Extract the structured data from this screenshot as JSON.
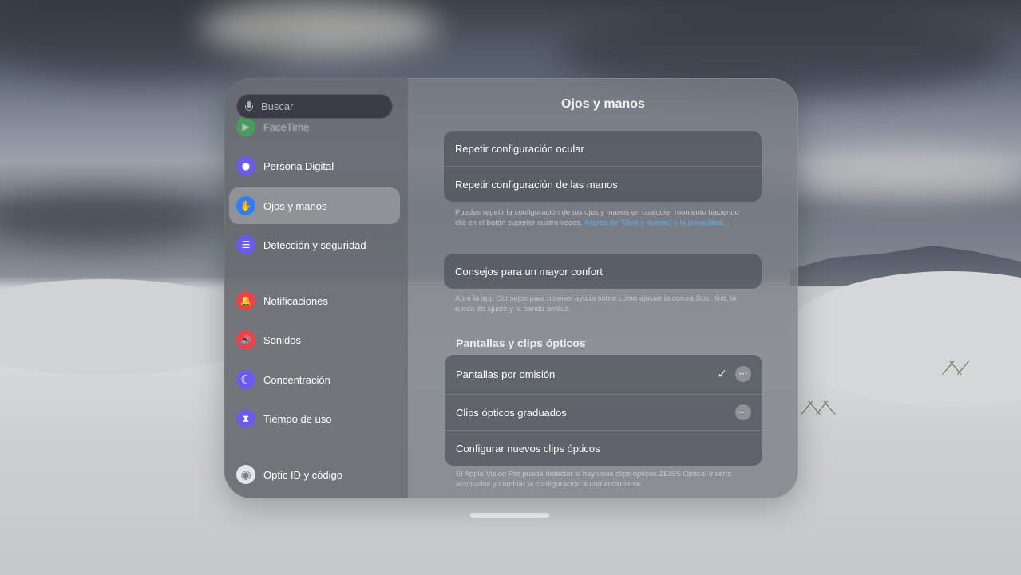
{
  "search": {
    "placeholder": "Buscar"
  },
  "sidebar": {
    "items": [
      {
        "label": "FaceTime",
        "icon": "facetime-icon",
        "color": "#30c24b",
        "glyph": "▶"
      },
      {
        "label": "Persona Digital",
        "icon": "persona-icon",
        "color": "#6a5ce8",
        "glyph": "●"
      },
      {
        "label": "Ojos y manos",
        "icon": "hand-icon",
        "color": "#2f7ef6",
        "glyph": "✋"
      },
      {
        "label": "Detección y seguridad",
        "icon": "sliders-icon",
        "color": "#6a5ce8",
        "glyph": "☰"
      },
      {
        "label": "Notificaciones",
        "icon": "bell-icon",
        "color": "#e8444a",
        "glyph": "🔔"
      },
      {
        "label": "Sonidos",
        "icon": "speaker-icon",
        "color": "#e8444a",
        "glyph": "🔊"
      },
      {
        "label": "Concentración",
        "icon": "moon-icon",
        "color": "#6a5ce8",
        "glyph": "☾"
      },
      {
        "label": "Tiempo de uso",
        "icon": "hourglass-icon",
        "color": "#6a5ce8",
        "glyph": "⧗"
      },
      {
        "label": "Optic ID y código",
        "icon": "eye-icon",
        "color": "#e4e5e7",
        "glyph": "◉"
      }
    ],
    "active_index": 2
  },
  "main": {
    "title": "Ojos y manos",
    "group1": {
      "rows": [
        "Repetir configuración ocular",
        "Repetir configuración de las manos"
      ],
      "footnote": "Puedes repetir la configuración de tus ojos y manos en cualquier momento haciendo clic en el botón superior cuatro veces.",
      "footnote_link": "Acerca de “Ojos y manos” y la privacidad…"
    },
    "group2": {
      "rows": [
        "Consejos para un mayor confort"
      ],
      "footnote": "Abre la app Consejos para obtener ayuda sobre cómo ajustar la correa Solo Knit, la rueda de ajuste y la banda antiluz."
    },
    "section3": {
      "title": "Pantallas y clips ópticos",
      "rows": [
        "Pantallas por omisión",
        "Clips ópticos graduados",
        "Configurar nuevos clips ópticos"
      ],
      "check_glyph": "✓",
      "more_glyph": "···",
      "footnote": "El Apple Vision Pro puede detectar si hay unos clips ópticos ZEISS Optical Inserts acoplados y cambiar la configuración automáticamente."
    }
  },
  "colors": {
    "link": "#5ab0ff",
    "window_glass": "#787c82"
  }
}
